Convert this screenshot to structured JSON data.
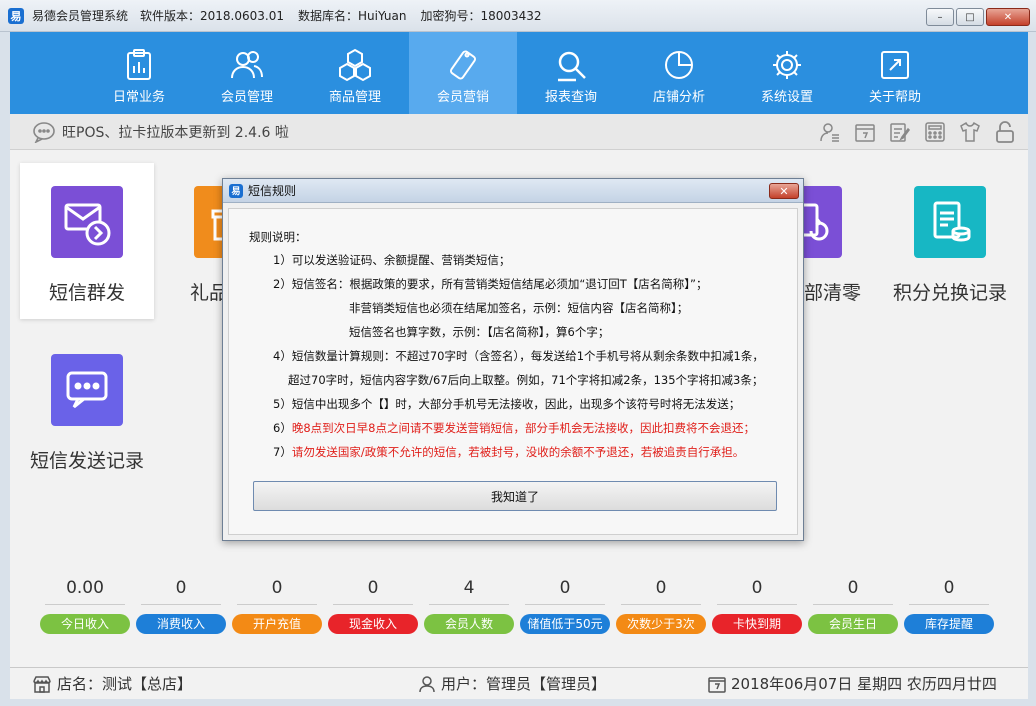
{
  "window": {
    "title": "易德会员管理系统",
    "version": "软件版本：2018.0603.01",
    "database": "数据库名：HuiYuan",
    "dongle": "加密狗号：18003432",
    "close_label": "✕",
    "min_label": "–",
    "max_label": "□"
  },
  "nav": {
    "items": [
      {
        "label": "日常业务",
        "icon": "clipboard-icon"
      },
      {
        "label": "会员管理",
        "icon": "users-icon"
      },
      {
        "label": "商品管理",
        "icon": "boxes-icon"
      },
      {
        "label": "会员营销",
        "icon": "tag-icon"
      },
      {
        "label": "报表查询",
        "icon": "report-search-icon"
      },
      {
        "label": "店铺分析",
        "icon": "pie-chart-icon"
      },
      {
        "label": "系统设置",
        "icon": "gear-icon"
      },
      {
        "label": "关于帮助",
        "icon": "help-icon"
      }
    ],
    "active_index": 3
  },
  "notice": {
    "text": "旺POS、拉卡拉版本更新到 2.4.6 啦"
  },
  "tiles": [
    {
      "label": "短信群发",
      "color": "#7b4fd6",
      "icon": "sms-send-icon"
    },
    {
      "label": "礼品",
      "color": "#f08c1c",
      "icon": "gift-icon"
    },
    {
      "label": "部清零",
      "color": "#7b4fd6",
      "icon": "reset-icon"
    },
    {
      "label": "积分兑换记录",
      "color": "#17b7c4",
      "icon": "points-exchange-icon"
    },
    {
      "label": "短信发送记录",
      "color": "#6a62e8",
      "icon": "sms-record-icon"
    }
  ],
  "stats": [
    {
      "value": "0.00",
      "label": "今日收入",
      "color": "#7cc242"
    },
    {
      "value": "0",
      "label": "消费收入",
      "color": "#1e7fd8"
    },
    {
      "value": "0",
      "label": "开户充值",
      "color": "#f38a15"
    },
    {
      "value": "0",
      "label": "现金收入",
      "color": "#e8242a"
    },
    {
      "value": "4",
      "label": "会员人数",
      "color": "#7cc242"
    },
    {
      "value": "0",
      "label": "储值低于50元",
      "color": "#1e7fd8"
    },
    {
      "value": "0",
      "label": "次数少于3次",
      "color": "#f38a15"
    },
    {
      "value": "0",
      "label": "卡快到期",
      "color": "#e8242a"
    },
    {
      "value": "0",
      "label": "会员生日",
      "color": "#7cc242"
    },
    {
      "value": "0",
      "label": "库存提醒",
      "color": "#1e7fd8"
    }
  ],
  "status": {
    "store": "店名：测试【总店】",
    "user": "用户：管理员【管理员】",
    "date": "2018年06月07日 星期四 农历四月廿四"
  },
  "dialog": {
    "title": "短信规则",
    "close_label": "✕",
    "heading": "规则说明：",
    "rule1": "1）可以发送验证码、余额提醒、营销类短信；",
    "rule2a": "2）短信签名：根据政策的要求，所有营销类短信结尾必须加“退订回T【店名简称】”；",
    "rule2b": "非营销类短信也必须在结尾加签名，示例：短信内容【店名简称】；",
    "rule2c": "短信签名也算字数，示例：【店名简称】，算6个字；",
    "rule4a": "4）短信数量计算规则：不超过70字时（含签名），每发送给1个手机号将从剩余条数中扣减1条，",
    "rule4b": "超过70字时，短信内容字数/67后向上取整。例如，71个字将扣减2条，135个字将扣减3条；",
    "rule5": "5）短信中出现多个【】时，大部分手机号无法接收，因此，出现多个该符号时将无法发送；",
    "rule6_prefix": "6）",
    "rule6": "晚8点到次日早8点之间请不要发送营销短信，部分手机会无法接收，因此扣费将不会退还；",
    "rule7_prefix": "7）",
    "rule7": "请勿发送国家/政策不允许的短信，若被封号，没收的余额不予退还，若被追责自行承担。",
    "ok_label": "我知道了"
  },
  "colors": {
    "nav_bg": "#2b8fdf",
    "nav_active": "#58aaee",
    "rule_red": "#e0201b"
  }
}
